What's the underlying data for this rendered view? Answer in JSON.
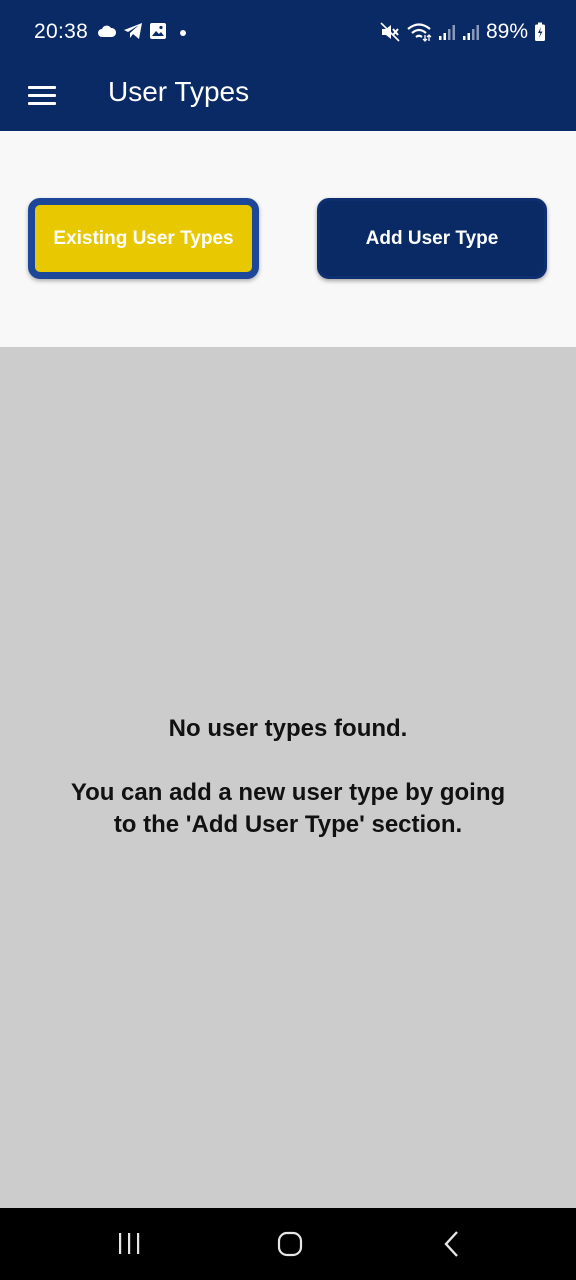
{
  "status_bar": {
    "time": "20:38",
    "battery_pct": "89%",
    "icons_left": [
      "cloud-icon",
      "telegram-icon",
      "image-icon",
      "dot-icon"
    ],
    "icons_right": [
      "mute-icon",
      "wifi-icon",
      "signal-icon",
      "signal-icon",
      "battery-icon"
    ]
  },
  "app_bar": {
    "title": "User Types",
    "menu_icon": "hamburger-menu-icon"
  },
  "tabs": {
    "existing_label": "Existing User Types",
    "add_label": "Add User Type",
    "selected": "existing"
  },
  "empty_state": {
    "title": "No user types found.",
    "description": "You can add a new user type by going to the 'Add User Type' section."
  },
  "nav_bar": {
    "icons": [
      "recent-apps-icon",
      "home-icon",
      "back-icon"
    ]
  },
  "colors": {
    "primary": "#0a2a66",
    "accent_yellow": "#e8c800",
    "selected_border": "#1d4799",
    "content_bg": "#cccccc",
    "tab_panel_bg": "#f8f8f8"
  }
}
